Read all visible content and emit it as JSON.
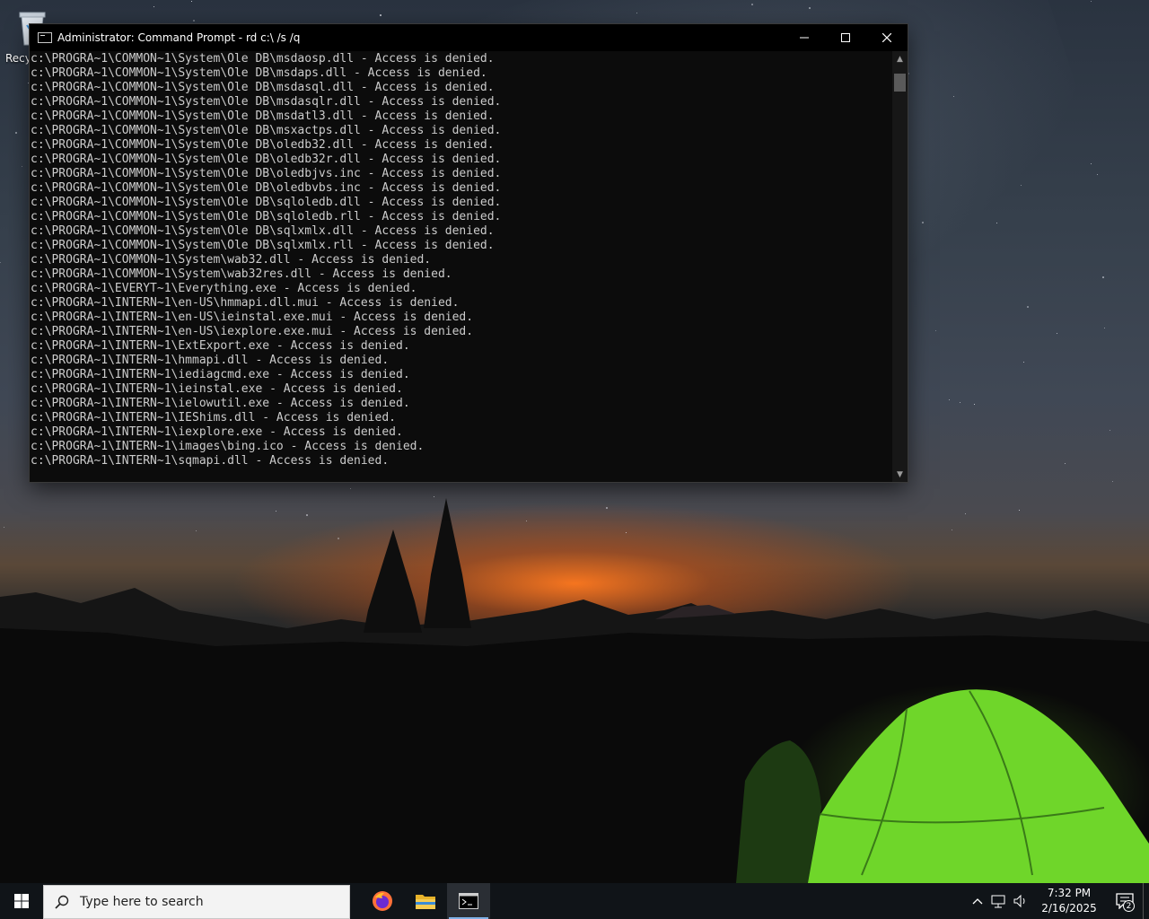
{
  "desktop": {
    "recycle_bin_label": "Recycle Bin"
  },
  "cmd": {
    "title": "Administrator: Command Prompt - rd  c:\\ /s /q",
    "controls": {
      "minimize": "—",
      "maximize": "☐",
      "close": "✕"
    },
    "lines": [
      "c:\\PROGRA~1\\COMMON~1\\System\\Ole DB\\msdaosp.dll - Access is denied.",
      "c:\\PROGRA~1\\COMMON~1\\System\\Ole DB\\msdaps.dll - Access is denied.",
      "c:\\PROGRA~1\\COMMON~1\\System\\Ole DB\\msdasql.dll - Access is denied.",
      "c:\\PROGRA~1\\COMMON~1\\System\\Ole DB\\msdasqlr.dll - Access is denied.",
      "c:\\PROGRA~1\\COMMON~1\\System\\Ole DB\\msdatl3.dll - Access is denied.",
      "c:\\PROGRA~1\\COMMON~1\\System\\Ole DB\\msxactps.dll - Access is denied.",
      "c:\\PROGRA~1\\COMMON~1\\System\\Ole DB\\oledb32.dll - Access is denied.",
      "c:\\PROGRA~1\\COMMON~1\\System\\Ole DB\\oledb32r.dll - Access is denied.",
      "c:\\PROGRA~1\\COMMON~1\\System\\Ole DB\\oledbjvs.inc - Access is denied.",
      "c:\\PROGRA~1\\COMMON~1\\System\\Ole DB\\oledbvbs.inc - Access is denied.",
      "c:\\PROGRA~1\\COMMON~1\\System\\Ole DB\\sqloledb.dll - Access is denied.",
      "c:\\PROGRA~1\\COMMON~1\\System\\Ole DB\\sqloledb.rll - Access is denied.",
      "c:\\PROGRA~1\\COMMON~1\\System\\Ole DB\\sqlxmlx.dll - Access is denied.",
      "c:\\PROGRA~1\\COMMON~1\\System\\Ole DB\\sqlxmlx.rll - Access is denied.",
      "c:\\PROGRA~1\\COMMON~1\\System\\wab32.dll - Access is denied.",
      "c:\\PROGRA~1\\COMMON~1\\System\\wab32res.dll - Access is denied.",
      "c:\\PROGRA~1\\EVERYT~1\\Everything.exe - Access is denied.",
      "c:\\PROGRA~1\\INTERN~1\\en-US\\hmmapi.dll.mui - Access is denied.",
      "c:\\PROGRA~1\\INTERN~1\\en-US\\ieinstal.exe.mui - Access is denied.",
      "c:\\PROGRA~1\\INTERN~1\\en-US\\iexplore.exe.mui - Access is denied.",
      "c:\\PROGRA~1\\INTERN~1\\ExtExport.exe - Access is denied.",
      "c:\\PROGRA~1\\INTERN~1\\hmmapi.dll - Access is denied.",
      "c:\\PROGRA~1\\INTERN~1\\iediagcmd.exe - Access is denied.",
      "c:\\PROGRA~1\\INTERN~1\\ieinstal.exe - Access is denied.",
      "c:\\PROGRA~1\\INTERN~1\\ielowutil.exe - Access is denied.",
      "c:\\PROGRA~1\\INTERN~1\\IEShims.dll - Access is denied.",
      "c:\\PROGRA~1\\INTERN~1\\iexplore.exe - Access is denied.",
      "c:\\PROGRA~1\\INTERN~1\\images\\bing.ico - Access is denied.",
      "c:\\PROGRA~1\\INTERN~1\\sqmapi.dll - Access is denied."
    ]
  },
  "taskbar": {
    "search_placeholder": "Type here to search",
    "apps": [
      {
        "icon": "firefox-icon"
      },
      {
        "icon": "file-explorer-icon"
      },
      {
        "icon": "command-prompt-icon"
      }
    ],
    "clock": {
      "time": "7:32 PM",
      "date": "2/16/2025"
    },
    "notification_count": "2",
    "accent": "#7fb0e6"
  }
}
